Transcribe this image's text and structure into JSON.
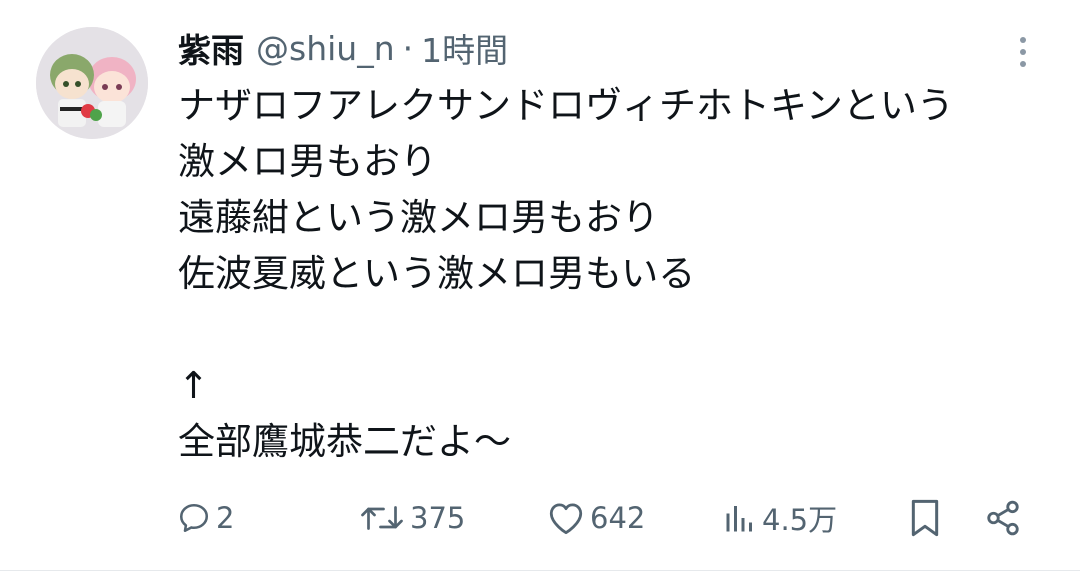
{
  "post": {
    "author_name": "紫雨",
    "handle": "@shiu_n",
    "separator": "·",
    "time": "1時間",
    "lines": [
      "ナザロフアレクサンドロヴィチホトキンという",
      "激メロ男もおり",
      "遠藤紺という激メロ男もおり",
      "佐波夏威という激メロ男もいる",
      "",
      "↑",
      "全部鷹城恭二だよ〜"
    ]
  },
  "actions": {
    "reply": {
      "icon": "reply-icon",
      "count": "2"
    },
    "repost": {
      "icon": "repost-icon",
      "count": "375"
    },
    "like": {
      "icon": "heart-icon",
      "count": "642"
    },
    "views": {
      "icon": "views-icon",
      "count": "4.5万"
    },
    "bookmark": {
      "icon": "bookmark-icon"
    },
    "share": {
      "icon": "share-icon"
    }
  },
  "colors": {
    "text": "#0f1419",
    "secondary": "#536471",
    "background": "#ffffff"
  }
}
